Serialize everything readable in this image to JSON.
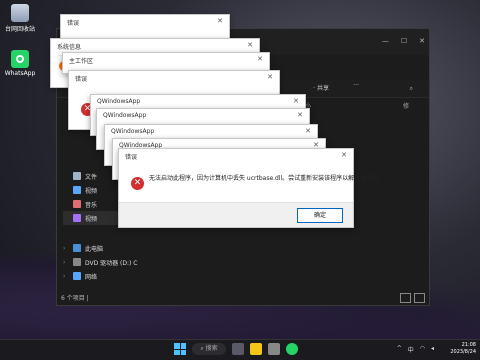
{
  "desktop": {
    "icons": [
      {
        "label": "台网回收站"
      },
      {
        "label": "WhatsApp"
      }
    ]
  },
  "explorer": {
    "toolbar": {
      "share": "· 共享",
      "ellipsis": "···"
    },
    "columns": [
      "大小",
      "修"
    ],
    "sidebar": [
      {
        "label": "文件"
      },
      {
        "label": "视频"
      },
      {
        "label": "音乐"
      },
      {
        "label": "视频",
        "active": true
      }
    ],
    "sidebar_lower": [
      {
        "label": "此电脑"
      },
      {
        "label": "DVD 驱动器 (D:) C"
      },
      {
        "label": "网络"
      }
    ],
    "status": "6 个项目 |"
  },
  "dialogs": [
    {
      "title": "错误"
    },
    {
      "title": "系统信息"
    },
    {
      "title": "主工作区"
    },
    {
      "title": "错误"
    },
    {
      "title": "QWindowsApp"
    },
    {
      "title": "QWindowsApp"
    },
    {
      "title": "QWindowsApp"
    },
    {
      "title": "QWindowsApp"
    }
  ],
  "main_dialog": {
    "title": "错误",
    "message": "无法启动此程序，因为计算机中丢失 ucrtbase.dll。尝试重新安装该程序以解决此问题。",
    "ok": "确定"
  },
  "taskbar": {
    "search": "搜索",
    "time": "21:08",
    "date": "2023/8/24",
    "ime": "中"
  }
}
